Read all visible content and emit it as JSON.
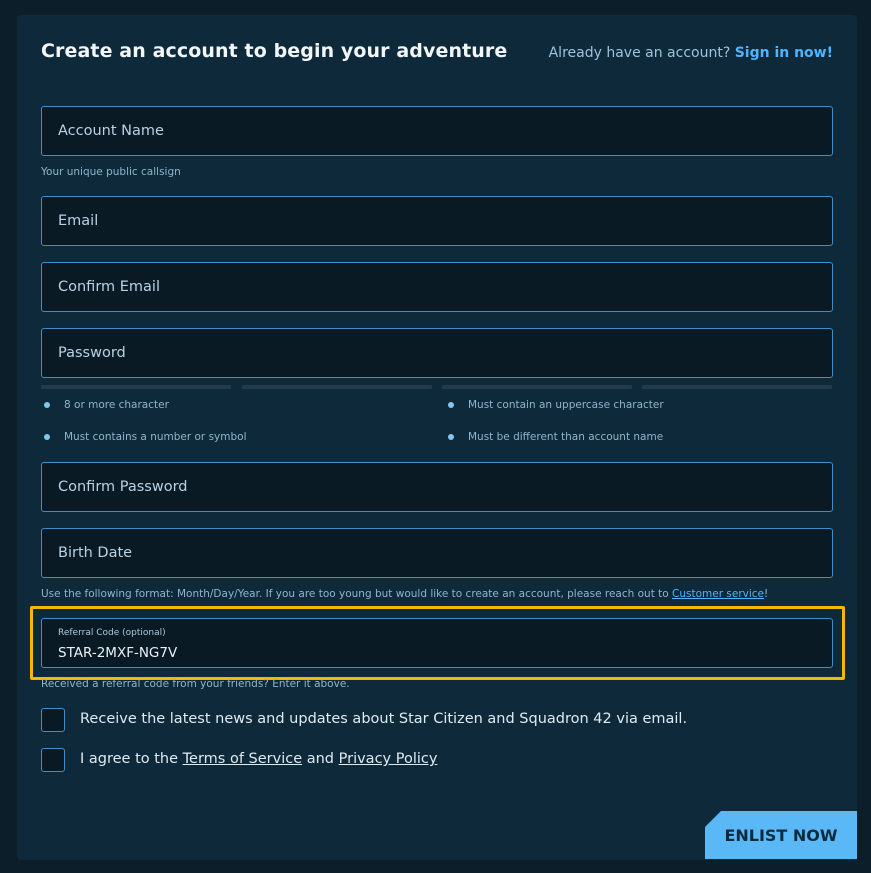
{
  "header": {
    "title": "Create an account to begin your adventure",
    "signin_prompt": "Already have an account?",
    "signin_link": "Sign in now!"
  },
  "fields": {
    "account_name": {
      "placeholder": "Account Name",
      "hint": "Your unique public callsign"
    },
    "email": {
      "placeholder": "Email"
    },
    "confirm_email": {
      "placeholder": "Confirm Email"
    },
    "password": {
      "placeholder": "Password"
    },
    "confirm_password": {
      "placeholder": "Confirm Password"
    },
    "birth_date": {
      "placeholder": "Birth Date",
      "hint_text": "Use the following format: Month/Day/Year. If you are too young but would like to create an account, please reach out to ",
      "hint_link": "Customer service",
      "hint_end": "!"
    },
    "referral": {
      "label": "Referral Code (optional)",
      "value": "STAR-2MXF-NG7V",
      "hint": "Received a referral code from your friends? Enter it above."
    }
  },
  "password_rules": [
    "8 or more character",
    "Must contain an uppercase character",
    "Must contains a number or symbol",
    "Must be different than account name"
  ],
  "checkboxes": {
    "newsletter": "Receive the latest news and updates about Star Citizen and Squadron 42 via email.",
    "terms_prefix": "I agree to the ",
    "terms_link": "Terms of Service",
    "terms_and": " and ",
    "privacy_link": "Privacy Policy"
  },
  "submit_label": "ENLIST NOW",
  "colors": {
    "background": "#0b1e2a",
    "panel": "#0e2a3a",
    "field_border": "#3e8fc6",
    "accent": "#4fb3ff",
    "button": "#5ab8f7",
    "highlight": "#f5b800"
  }
}
